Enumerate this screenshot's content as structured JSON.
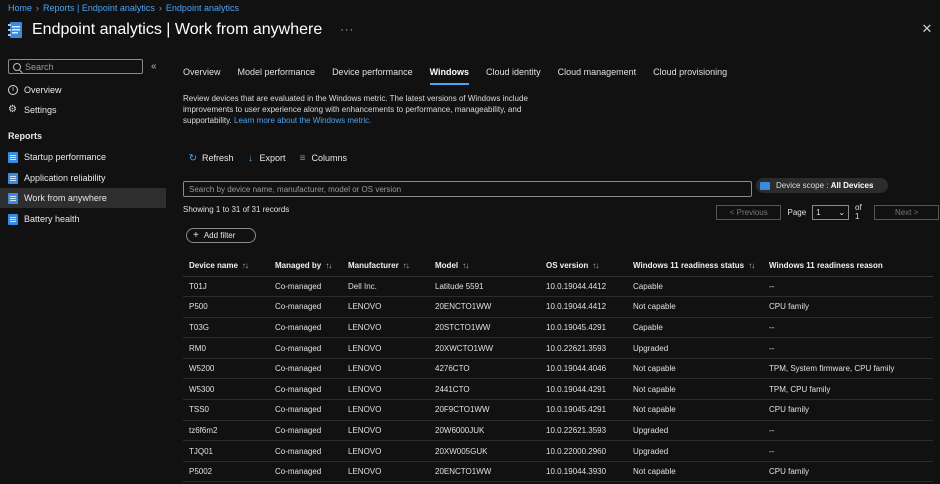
{
  "breadcrumb": [
    "Home",
    "Reports | Endpoint analytics",
    "Endpoint analytics"
  ],
  "title": "Endpoint analytics | Work from anywhere",
  "sidebar": {
    "search_placeholder": "Search",
    "top_items": [
      {
        "label": "Overview",
        "icon": "info-icon"
      },
      {
        "label": "Settings",
        "icon": "gear-icon"
      }
    ],
    "section": "Reports",
    "report_items": [
      {
        "label": "Startup performance",
        "active": false
      },
      {
        "label": "Application reliability",
        "active": false
      },
      {
        "label": "Work from anywhere",
        "active": true
      },
      {
        "label": "Battery health",
        "active": false
      }
    ]
  },
  "tabs": [
    {
      "label": "Overview",
      "active": false
    },
    {
      "label": "Model performance",
      "active": false
    },
    {
      "label": "Device performance",
      "active": false
    },
    {
      "label": "Windows",
      "active": true
    },
    {
      "label": "Cloud identity",
      "active": false
    },
    {
      "label": "Cloud management",
      "active": false
    },
    {
      "label": "Cloud provisioning",
      "active": false
    }
  ],
  "description": {
    "text": "Review devices that are evaluated in the Windows metric. The latest versions of Windows include improvements to user experience along with enhancements to performance, manageability, and supportability. ",
    "link": "Learn more about the Windows metric."
  },
  "toolbar": {
    "refresh": "Refresh",
    "export": "Export",
    "columns": "Columns"
  },
  "grid": {
    "search_placeholder": "Search by device name, manufacturer, model or OS version",
    "scope_label": "Device scope : ",
    "scope_value": "All Devices",
    "records_text": "Showing 1 to 31 of 31 records",
    "prev": "< Previous",
    "page_label": "Page",
    "page_value": "1",
    "page_of": "of 1",
    "next": "Next >",
    "add_filter": "Add filter"
  },
  "table": {
    "columns": [
      {
        "label": "Device name",
        "sortable": true
      },
      {
        "label": "Managed by",
        "sortable": true
      },
      {
        "label": "Manufacturer",
        "sortable": true
      },
      {
        "label": "Model",
        "sortable": true
      },
      {
        "label": "OS version",
        "sortable": true
      },
      {
        "label": "Windows 11 readiness status",
        "sortable": true
      },
      {
        "label": "Windows 11 readiness reason",
        "sortable": false
      }
    ],
    "rows": [
      [
        "T01J",
        "Co-managed",
        "Dell Inc.",
        "Latitude 5591",
        "10.0.19044.4412",
        "Capable",
        "--"
      ],
      [
        "P500",
        "Co-managed",
        "LENOVO",
        "20ENCTO1WW",
        "10.0.19044.4412",
        "Not capable",
        "CPU family"
      ],
      [
        "T03G",
        "Co-managed",
        "LENOVO",
        "20STCTO1WW",
        "10.0.19045.4291",
        "Capable",
        "--"
      ],
      [
        "RM0",
        "Co-managed",
        "LENOVO",
        "20XWCTO1WW",
        "10.0.22621.3593",
        "Upgraded",
        "--"
      ],
      [
        "W5200",
        "Co-managed",
        "LENOVO",
        "4276CTO",
        "10.0.19044.4046",
        "Not capable",
        "TPM, System firmware, CPU family"
      ],
      [
        "W5300",
        "Co-managed",
        "LENOVO",
        "2441CTO",
        "10.0.19044.4291",
        "Not capable",
        "TPM, CPU family"
      ],
      [
        "TSS0",
        "Co-managed",
        "LENOVO",
        "20F9CTO1WW",
        "10.0.19045.4291",
        "Not capable",
        "CPU family"
      ],
      [
        "tz6f6m2",
        "Co-managed",
        "LENOVO",
        "20W6000JUK",
        "10.0.22621.3593",
        "Upgraded",
        "--"
      ],
      [
        "TJQ01",
        "Co-managed",
        "LENOVO",
        "20XW005GUK",
        "10.0.22000.2960",
        "Upgraded",
        "--"
      ],
      [
        "P5002",
        "Co-managed",
        "LENOVO",
        "20ENCTO1WW",
        "10.0.19044.3930",
        "Not capable",
        "CPU family"
      ]
    ]
  }
}
